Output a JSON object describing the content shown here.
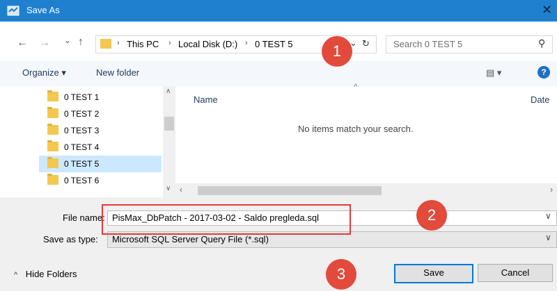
{
  "window": {
    "title": "Save As",
    "close_glyph": "✕"
  },
  "address": {
    "back_glyph": "←",
    "forward_glyph": "→",
    "recent_glyph": "⌄",
    "up_glyph": "↑",
    "breadcrumbs": [
      "This PC",
      "Local Disk (D:)",
      "0 TEST 5"
    ],
    "separator": "›",
    "dropdown_glyph": "⌄",
    "refresh_glyph": "↻"
  },
  "search": {
    "placeholder": "Search 0 TEST 5",
    "icon_glyph": "⚲"
  },
  "toolbar": {
    "organize_label": "Organize ▾",
    "new_folder_label": "New folder",
    "view_glyph": "▤ ▾",
    "help_glyph": "?"
  },
  "nav": {
    "items": [
      {
        "label": "0 TEST 1",
        "selected": false
      },
      {
        "label": "0 TEST 2",
        "selected": false
      },
      {
        "label": "0 TEST 3",
        "selected": false
      },
      {
        "label": "0 TEST 4",
        "selected": false
      },
      {
        "label": "0 TEST 5",
        "selected": true
      },
      {
        "label": "0 TEST 6",
        "selected": false
      }
    ]
  },
  "content": {
    "columns": [
      "Name",
      "Date"
    ],
    "sort_glyph": "^",
    "empty_message": "No items match your search."
  },
  "form": {
    "filename_label": "File name:",
    "filename_value": "PisMax_DbPatch - 2017-03-02 -  Saldo pregleda.sql",
    "type_label": "Save as type:",
    "type_value": "Microsoft SQL Server Query File (*.sql)",
    "hide_folders_label": "Hide Folders",
    "hide_glyph": "^",
    "save_label": "Save",
    "cancel_label": "Cancel"
  },
  "annotations": [
    "1",
    "2",
    "3"
  ],
  "colors": {
    "titlebar": "#1f80d0",
    "selection": "#cce8ff",
    "annotation": "#e24a3b"
  }
}
